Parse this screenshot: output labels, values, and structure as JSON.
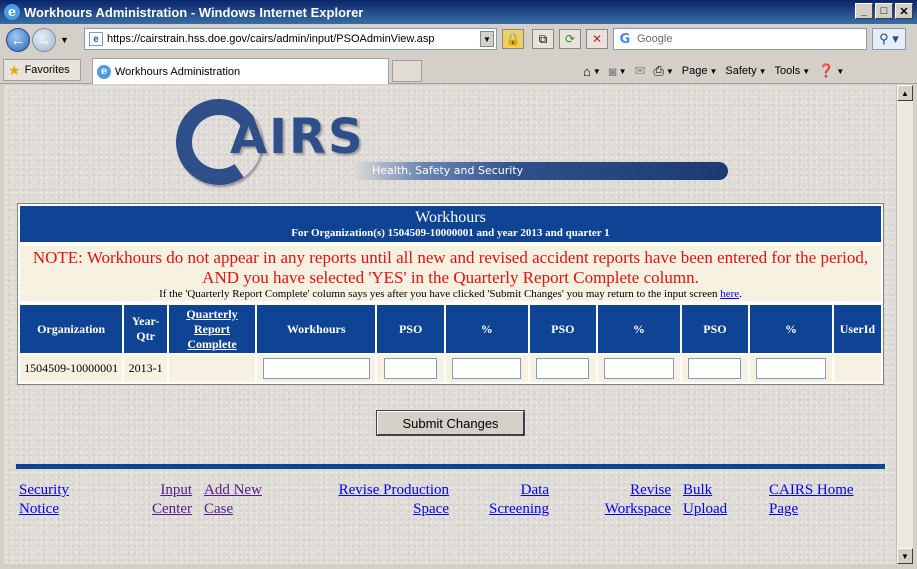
{
  "window": {
    "title": "Workhours Administration - Windows Internet Explorer",
    "url": "https://cairstrain.hss.doe.gov/cairs/admin/input/PSOAdminView.asp",
    "search_placeholder": "Google",
    "favorites_label": "Favorites",
    "tab_title": "Workhours Administration",
    "commands": [
      "Page",
      "Safety",
      "Tools"
    ]
  },
  "logo": {
    "text": "AIRS",
    "subtitle": "Health, Safety and Security"
  },
  "header": {
    "title": "Workhours",
    "subtitle": "For Organization(s) 1504509-10000001   and year 2013 and quarter 1"
  },
  "note": {
    "warning": "NOTE: Workhours do not appear in any reports until all new and revised accident reports have been entered for the period, AND you have selected 'YES' in the Quarterly Report Complete column.",
    "instruction_prefix": "If the 'Quarterly Report Complete' column says yes after you have clicked 'Submit Changes' you may return to the input screen ",
    "link_text": "here",
    "instruction_suffix": "."
  },
  "table": {
    "columns": [
      "Organization",
      "Year-Qtr",
      "Quarterly Report Complete",
      "Workhours",
      "PSO",
      "%",
      "PSO",
      "%",
      "PSO",
      "%",
      "UserId"
    ],
    "rows": [
      {
        "organization": "1504509-10000001",
        "year_qtr": "2013-1",
        "quarterly_report_complete": "",
        "userid": ""
      }
    ]
  },
  "submit_label": "Submit Changes",
  "footer": {
    "security_1": "Security",
    "security_2": "Notice",
    "input_1": "Input",
    "input_2": "Center",
    "addnew_1": "Add New",
    "addnew_2": "Case",
    "revise_1": "Revise Production",
    "revise_2": "Space",
    "data_1": "Data",
    "data_2": "Screening",
    "workspace_1": "Revise",
    "workspace_2": "Workspace",
    "bulk_1": "Bulk",
    "bulk_2": "Upload",
    "home_1": "CAIRS Home",
    "home_2": "Page"
  }
}
